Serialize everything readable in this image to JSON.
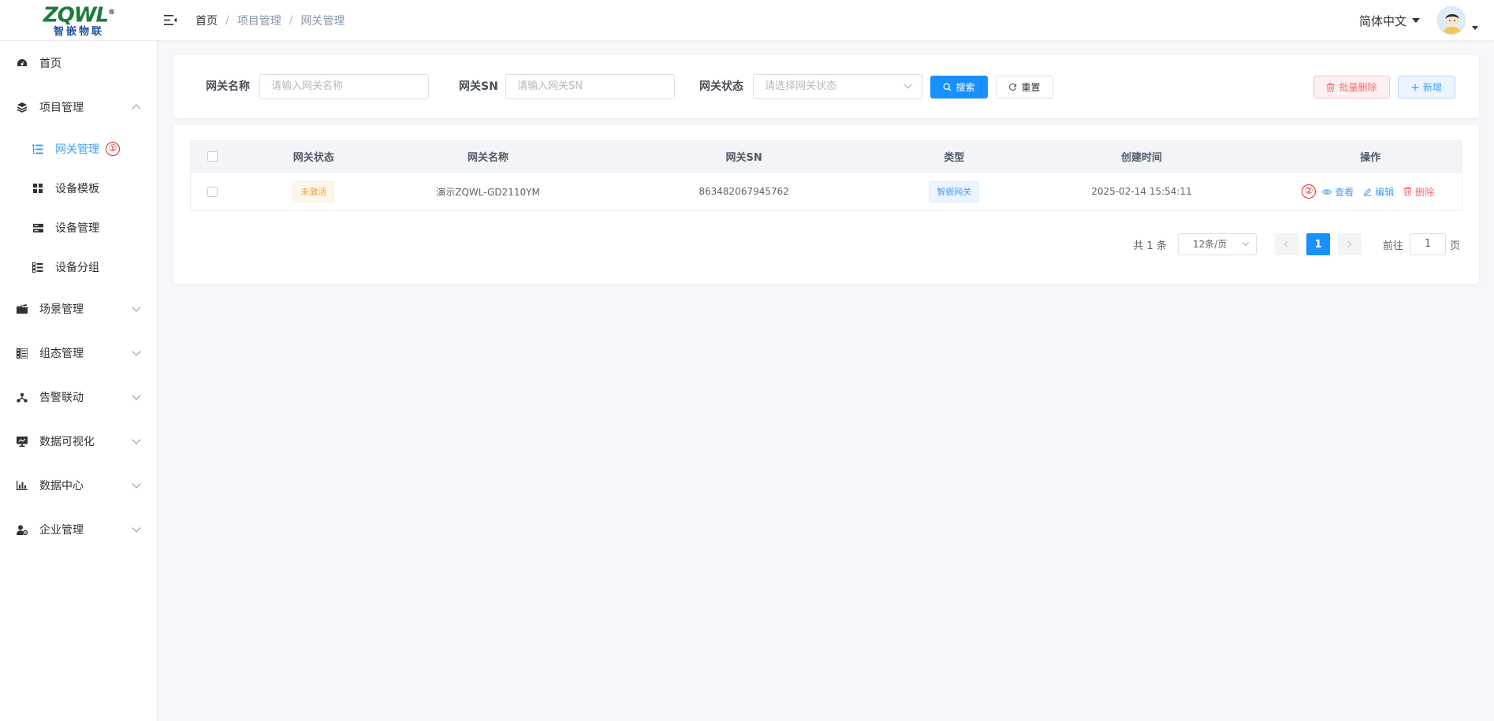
{
  "header": {
    "logo_text": "ZQWL",
    "logo_mark": "®",
    "logo_subtitle": "智嵌物联",
    "breadcrumb": [
      "首页",
      "项目管理",
      "网关管理"
    ],
    "breadcrumb_sep": "/",
    "language": "简体中文"
  },
  "sidebar": {
    "items": [
      {
        "label": "首页",
        "icon": "dashboard-icon"
      },
      {
        "label": "项目管理",
        "icon": "layers-icon",
        "expanded": true
      },
      {
        "label": "场景管理",
        "icon": "clapper-icon"
      },
      {
        "label": "组态管理",
        "icon": "config-icon"
      },
      {
        "label": "告警联动",
        "icon": "nodes-icon"
      },
      {
        "label": "数据可视化",
        "icon": "monitor-icon"
      },
      {
        "label": "数据中心",
        "icon": "bar-chart-icon"
      },
      {
        "label": "企业管理",
        "icon": "user-gear-icon"
      }
    ],
    "sub_items": [
      {
        "label": "网关管理",
        "icon": "list-tree-icon",
        "active": true,
        "annotation": "①"
      },
      {
        "label": "设备模板",
        "icon": "grid-icon"
      },
      {
        "label": "设备管理",
        "icon": "server-icon"
      },
      {
        "label": "设备分组",
        "icon": "group-icon"
      }
    ]
  },
  "search": {
    "name_label": "网关名称",
    "name_placeholder": "请输入网关名称",
    "sn_label": "网关SN",
    "sn_placeholder": "请输入网关SN",
    "status_label": "网关状态",
    "status_placeholder": "请选择网关状态",
    "search_btn": "搜索",
    "reset_btn": "重置",
    "batch_delete_btn": "批量删除",
    "add_btn": "新增"
  },
  "table": {
    "columns": [
      "网关状态",
      "网关名称",
      "网关SN",
      "类型",
      "创建时间",
      "操作"
    ],
    "rows": [
      {
        "status": "未激活",
        "name": "演示ZQWL-GD2110YM",
        "sn": "863482067945762",
        "type": "智嵌网关",
        "created": "2025-02-14 15:54:11",
        "annotation": "②",
        "actions": {
          "view": "查看",
          "edit": "编辑",
          "delete": "删除"
        }
      }
    ]
  },
  "pagination": {
    "total": "共 1 条",
    "page_size": "12条/页",
    "current_page": "1",
    "goto_label": "前往",
    "goto_value": "1",
    "page_suffix": "页"
  },
  "colors": {
    "primary": "#1890ff",
    "link": "#409eff",
    "danger": "#f56c6c",
    "warning": "#e6a23c",
    "annotation": "#e02020"
  }
}
